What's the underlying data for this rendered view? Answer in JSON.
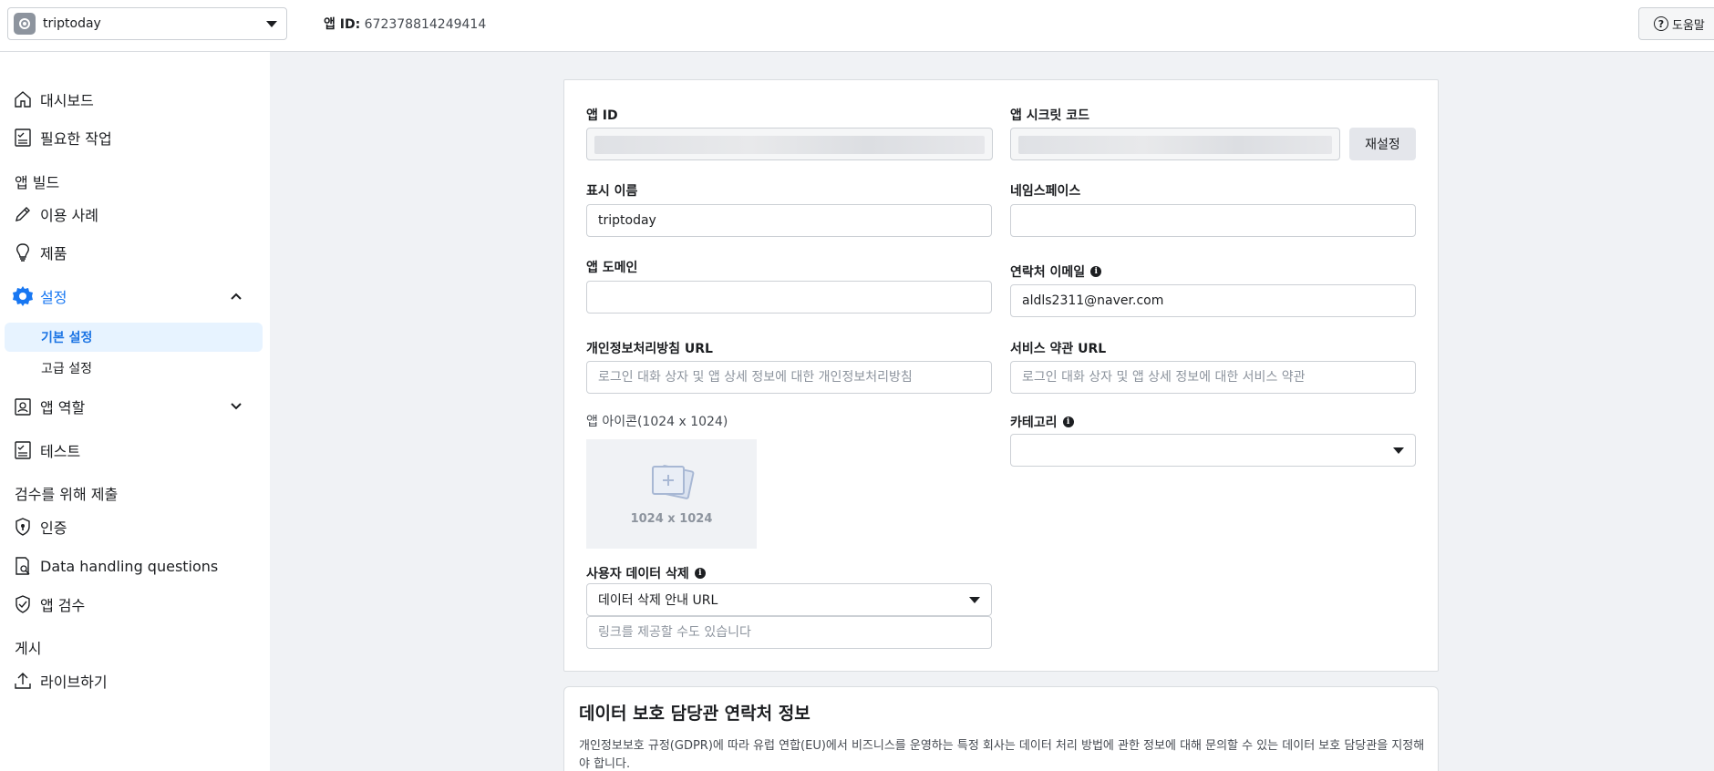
{
  "header": {
    "app_name": "triptoday",
    "app_id_label": "앱 ID:",
    "app_id_value": "672378814249414",
    "help_label": "도움말"
  },
  "sidebar": {
    "dashboard": "대시보드",
    "required_tasks": "필요한 작업",
    "section_build": "앱 빌드",
    "use_cases": "이용 사례",
    "products": "제품",
    "settings": "설정",
    "basic_settings": "기본 설정",
    "advanced_settings": "고급 설정",
    "app_roles": "앱 역할",
    "test": "테스트",
    "section_review": "검수를 위해 제출",
    "verification": "인증",
    "data_handling": "Data handling questions",
    "app_review": "앱 검수",
    "section_publish": "게시",
    "go_live": "라이브하기"
  },
  "form": {
    "app_id_label": "앱 ID",
    "app_secret_label": "앱 시크릿 코드",
    "reset_button": "재설정",
    "display_name_label": "표시 이름",
    "display_name_value": "triptoday",
    "namespace_label": "네임스페이스",
    "namespace_value": "",
    "app_domain_label": "앱 도메인",
    "contact_email_label": "연락처 이메일",
    "contact_email_value": "aldls2311@naver.com",
    "privacy_url_label": "개인정보처리방침 URL",
    "privacy_url_placeholder": "로그인 대화 상자 및 앱 상세 정보에 대한 개인정보처리방침",
    "tos_url_label": "서비스 약관 URL",
    "tos_url_placeholder": "로그인 대화 상자 및 앱 상세 정보에 대한 서비스 약관",
    "app_icon_label": "앱 아이콘(1024 x 1024)",
    "app_icon_size": "1024 x 1024",
    "category_label": "카테고리",
    "category_value": "",
    "data_deletion_label": "사용자 데이터 삭제",
    "data_deletion_select": "데이터 삭제 안내 URL",
    "data_deletion_placeholder": "링크를 제공할 수도 있습니다"
  },
  "dpo": {
    "title": "데이터 보호 담당관 연락처 정보",
    "description": "개인정보보호 규정(GDPR)에 따라 유럽 연합(EU)에서 비즈니스를 운영하는 특정 회사는 데이터 처리 방법에 관한 정보에 대해 문의할 수 있는 데이터 보호 담당관을 지정해야 합니다."
  },
  "colors": {
    "accent": "#1877f2",
    "active_bg": "#e7f3ff",
    "page_bg": "#f0f2f5"
  }
}
